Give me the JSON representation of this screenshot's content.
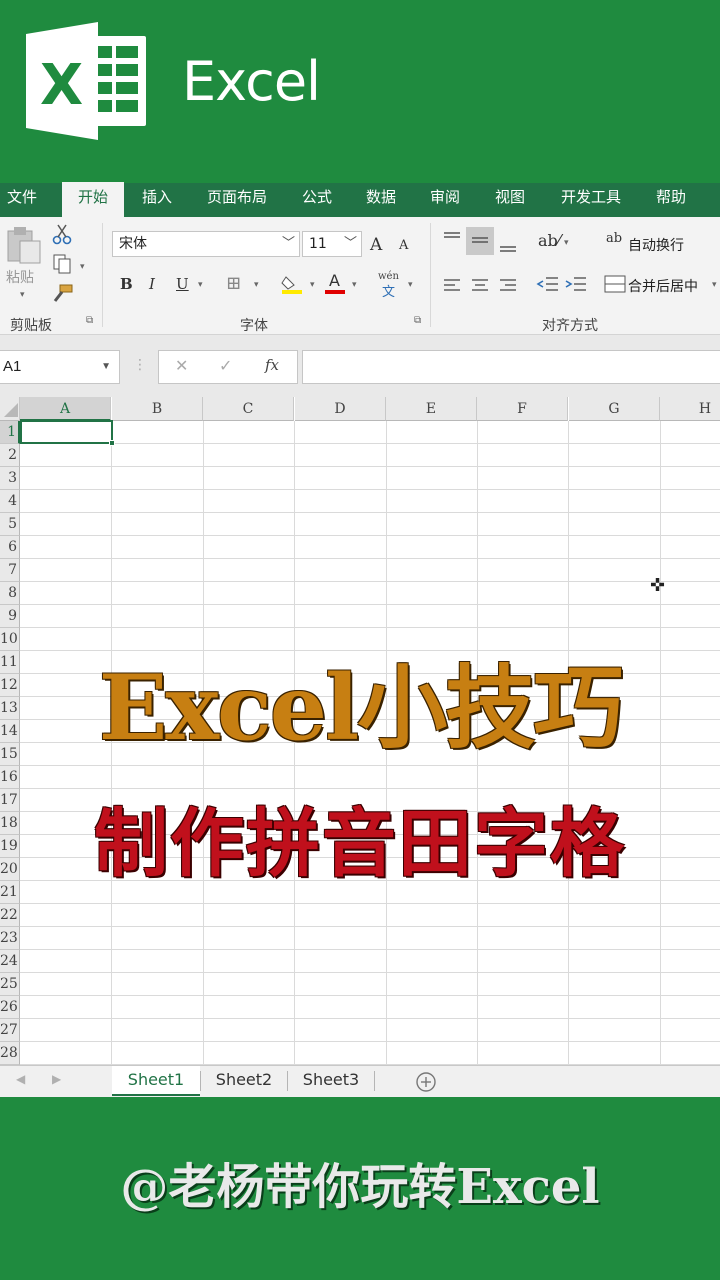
{
  "app": {
    "name": "Excel",
    "brand_color": "#217346"
  },
  "ribbon_tabs": [
    "文件",
    "开始",
    "插入",
    "页面布局",
    "公式",
    "数据",
    "审阅",
    "视图",
    "开发工具",
    "帮助"
  ],
  "ribbon": {
    "clipboard": {
      "paste_label": "粘贴",
      "group_label": "剪贴板"
    },
    "font": {
      "name": "宋体",
      "size": "11",
      "group_label": "字体",
      "bold": "B",
      "italic": "I",
      "underline": "U",
      "grow": "A",
      "shrink": "A",
      "phonetic": "wén"
    },
    "alignment": {
      "wrap_label": "自动换行",
      "merge_label": "合并后居中",
      "group_label": "对齐方式"
    }
  },
  "formula_bar": {
    "name_box": "A1",
    "fx": "fx",
    "cancel": "✕",
    "enter": "✓",
    "value": ""
  },
  "grid": {
    "columns": [
      "A",
      "B",
      "C",
      "D",
      "E",
      "F",
      "G",
      "H"
    ],
    "rows": [
      "1",
      "2",
      "3",
      "4",
      "5",
      "6",
      "7",
      "8",
      "9",
      "10",
      "11",
      "12",
      "13",
      "14",
      "15",
      "16",
      "17",
      "18",
      "19",
      "20",
      "21",
      "22",
      "23",
      "24",
      "25",
      "26",
      "27",
      "28"
    ],
    "selected_cell": "A1"
  },
  "overlay": {
    "title": "Excel小技巧",
    "subtitle": "制作拼音田字格"
  },
  "sheets": [
    "Sheet1",
    "Sheet2",
    "Sheet3"
  ],
  "active_sheet": "Sheet1",
  "footer": {
    "handle": "@老杨带你玩转Excel"
  }
}
